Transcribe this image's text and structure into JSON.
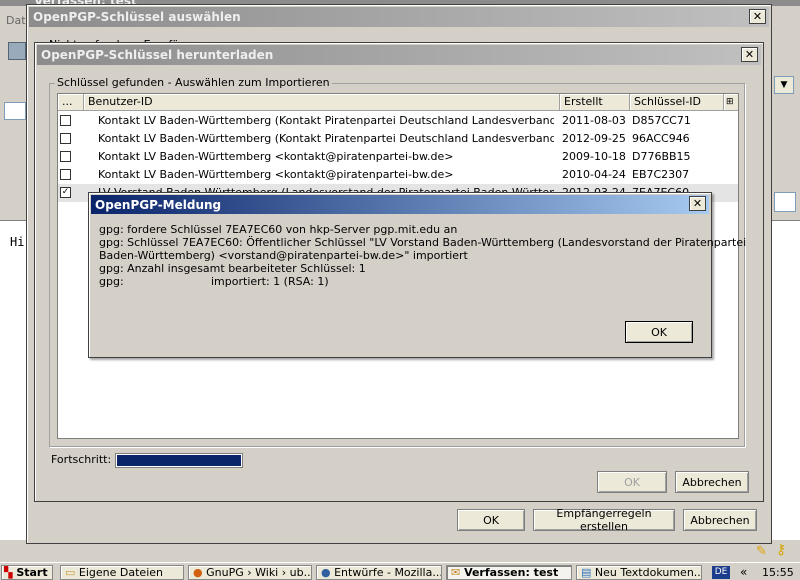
{
  "background_window": {
    "title": "Verfassen: test",
    "menu_hint": "Datei",
    "body_text": "Hi"
  },
  "select_dialog": {
    "title": "OpenPGP-Schlüssel auswählen",
    "partial_label": "Nicht gefundene Empfänger",
    "buttons": {
      "ok": "OK",
      "rules": "Empfängerregeln erstellen",
      "cancel": "Abbrechen"
    }
  },
  "download_dialog": {
    "title": "OpenPGP-Schlüssel herunterladen",
    "group_label": "Schlüssel gefunden - Auswählen zum Importieren",
    "columns": [
      "...",
      "Benutzer-ID",
      "Erstellt",
      "Schlüssel-ID"
    ],
    "rows": [
      {
        "checked": false,
        "user_id": "Kontakt LV Baden-Württemberg (Kontakt Piratenpartei Deutschland Landesverband Baden-W...",
        "created": "2011-08-03",
        "key_id": "D857CC71"
      },
      {
        "checked": false,
        "user_id": "Kontakt LV Baden-Württemberg (Kontakt Piratenpartei Deutschland Landesverband Baden-W...",
        "created": "2012-09-25",
        "key_id": "96ACC946"
      },
      {
        "checked": false,
        "user_id": "Kontakt LV Baden-Württemberg <kontakt@piratenpartei-bw.de>",
        "created": "2009-10-18",
        "key_id": "D776BB15"
      },
      {
        "checked": false,
        "user_id": "Kontakt LV Baden-Württemberg <kontakt@piratenpartei-bw.de>",
        "created": "2010-04-24",
        "key_id": "EB7C2307"
      },
      {
        "checked": true,
        "user_id": "LV Vorstand Baden-Württemberg (Landesvorstand der Piratenpartei Baden-Württemberg) <v...",
        "created": "2012-03-24",
        "key_id": "7EA7EC60"
      }
    ],
    "progress_label": "Fortschritt:",
    "progress": 1.0,
    "buttons": {
      "ok": "OK",
      "cancel": "Abbrechen"
    }
  },
  "message_dialog": {
    "title": "OpenPGP-Meldung",
    "lines": [
      "gpg: fordere Schlüssel 7EA7EC60 von hkp-Server pgp.mit.edu an",
      "gpg: Schlüssel 7EA7EC60: Öffentlicher Schlüssel \"LV Vorstand Baden-Württemberg (Landesvorstand der Piratenpartei",
      "Baden-Württemberg) <vorstand@piratenpartei-bw.de>\" importiert",
      "gpg: Anzahl insgesamt bearbeiteter Schlüssel: 1",
      "gpg:"
    ],
    "imported_text": "importiert: 1  (RSA: 1)",
    "ok_label": "OK"
  },
  "taskbar": {
    "start_label": "Start",
    "items": [
      "Eigene Dateien",
      "GnuPG › Wiki › ub...",
      "Entwürfe - Mozilla...",
      "Verfassen: test",
      "Neu Textdokumen..."
    ],
    "language": "DE",
    "chevron": "«",
    "clock": "15:55"
  },
  "colors": {
    "title_active": "#0a246a",
    "title_inactive": "#8c8c8c",
    "progress_fill": "#0a246a",
    "dialog_bg": "#d4d0c8"
  }
}
